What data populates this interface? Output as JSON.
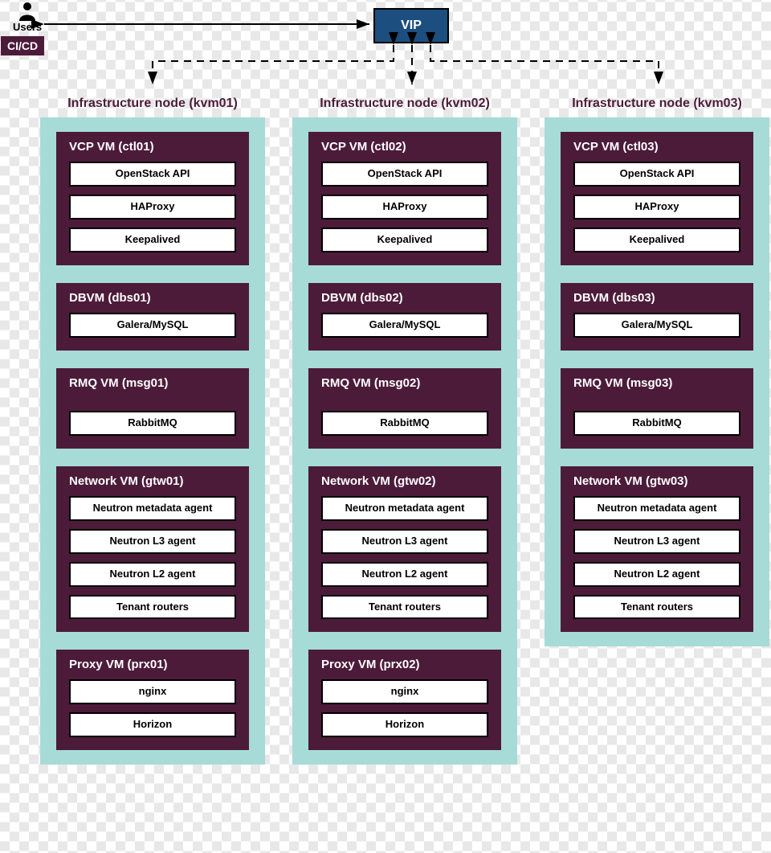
{
  "users_label": "Users",
  "cicd_label": "CI/CD",
  "vip_label": "VIP",
  "nodes": [
    {
      "title": "Infrastructure node (kvm01)",
      "vms": [
        {
          "title": "VCP VM (ctl01)",
          "cls": "",
          "services": [
            "OpenStack API",
            "HAProxy",
            "Keepalived"
          ]
        },
        {
          "title": "DBVM (dbs01)",
          "cls": "",
          "services": [
            "Galera/MySQL"
          ]
        },
        {
          "title": "RMQ VM (msg01)",
          "cls": "rmq",
          "services": [
            "RabbitMQ"
          ]
        },
        {
          "title": "Network VM (gtw01)",
          "cls": "",
          "services": [
            "Neutron metadata agent",
            "Neutron L3 agent",
            "Neutron L2 agent",
            "Tenant routers"
          ]
        },
        {
          "title": "Proxy VM (prx01)",
          "cls": "",
          "services": [
            "nginx",
            "Horizon"
          ]
        }
      ]
    },
    {
      "title": "Infrastructure node (kvm02)",
      "vms": [
        {
          "title": "VCP VM (ctl02)",
          "cls": "",
          "services": [
            "OpenStack API",
            "HAProxy",
            "Keepalived"
          ]
        },
        {
          "title": "DBVM (dbs02)",
          "cls": "",
          "services": [
            "Galera/MySQL"
          ]
        },
        {
          "title": "RMQ VM (msg02)",
          "cls": "rmq",
          "services": [
            "RabbitMQ"
          ]
        },
        {
          "title": "Network VM (gtw02)",
          "cls": "",
          "services": [
            "Neutron metadata agent",
            "Neutron L3 agent",
            "Neutron L2 agent",
            "Tenant routers"
          ]
        },
        {
          "title": "Proxy VM (prx02)",
          "cls": "",
          "services": [
            "nginx",
            "Horizon"
          ]
        }
      ]
    },
    {
      "title": "Infrastructure node (kvm03)",
      "vms": [
        {
          "title": "VCP VM (ctl03)",
          "cls": "",
          "services": [
            "OpenStack API",
            "HAProxy",
            "Keepalived"
          ]
        },
        {
          "title": "DBVM (dbs03)",
          "cls": "",
          "services": [
            "Galera/MySQL"
          ]
        },
        {
          "title": "RMQ VM (msg03)",
          "cls": "rmq",
          "services": [
            "RabbitMQ"
          ]
        },
        {
          "title": "Network VM (gtw03)",
          "cls": "",
          "services": [
            "Neutron metadata agent",
            "Neutron L3 agent",
            "Neutron L2 agent",
            "Tenant routers"
          ]
        }
      ]
    }
  ]
}
